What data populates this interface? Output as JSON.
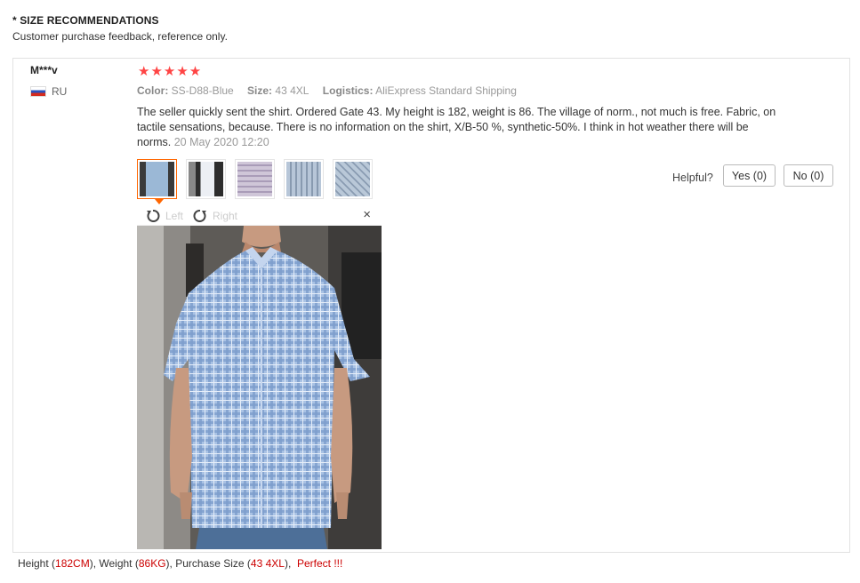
{
  "section": {
    "title": "* SIZE RECOMMENDATIONS",
    "subtitle": "Customer purchase feedback, reference only."
  },
  "review": {
    "user": "M***v",
    "country": "RU",
    "stars": "★★★★★",
    "rating": 5,
    "color_label": "Color:",
    "color_value": "SS-D88-Blue",
    "size_label": "Size:",
    "size_value": "43 4XL",
    "logistics_label": "Logistics:",
    "logistics_value": "AliExpress Standard Shipping",
    "text": "The seller quickly sent the shirt. Ordered Gate 43. My height is 182, weight is 86. The village of norm., not much is free. Fabric, on tactile sensations, because. There is no information on the shirt, X/B-50 %, synthetic-50%. I think in hot weather there will be norms.",
    "date": "20 May 2020 12:20",
    "thumbnails": [
      "shirt-front-photo",
      "shirt-back-photo",
      "fabric-label-photo",
      "fabric-closeup-photo",
      "fabric-pattern-photo"
    ],
    "helpful_label": "Helpful?",
    "yes_label": "Yes (0)",
    "no_label": "No (0)"
  },
  "viewer": {
    "rotate_left": "Left",
    "rotate_right": "Right",
    "close": "×"
  },
  "footer": {
    "height_label": "Height (",
    "height_value": "182CM",
    "weight_label": "), Weight (",
    "weight_value": "86KG",
    "size_label": "), Purchase Size (",
    "size_value": "43 4XL",
    "tail": "),",
    "verdict": "Perfect !!!"
  },
  "colors": {
    "stars": "#ff4444",
    "accent": "#ff6600",
    "highlight": "#cc0000"
  }
}
